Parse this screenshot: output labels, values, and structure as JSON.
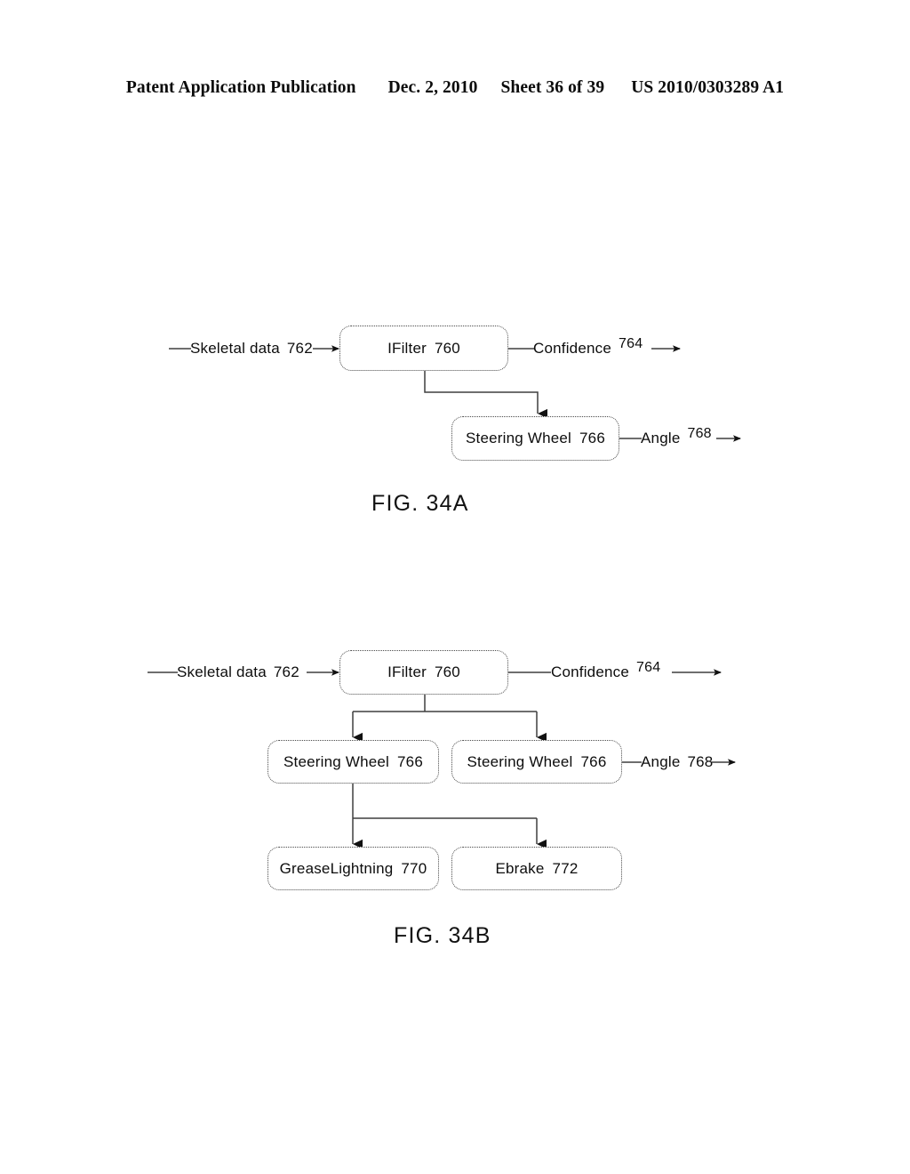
{
  "header": {
    "publication": "Patent Application Publication",
    "date": "Dec. 2, 2010",
    "sheet": "Sheet 36 of 39",
    "patent_number": "US 2010/0303289 A1"
  },
  "figures": [
    {
      "id": "fig-34a",
      "caption": "FIG. 34A",
      "nodes": [
        {
          "id": "a-ifilter",
          "label": "IFilter",
          "ref": "760"
        },
        {
          "id": "a-steering",
          "label": "Steering Wheel",
          "ref": "766"
        }
      ],
      "edge_labels": [
        {
          "id": "a-skeletal",
          "label": "Skeletal data",
          "ref": "762"
        },
        {
          "id": "a-confidence",
          "label": "Confidence",
          "ref": "764"
        },
        {
          "id": "a-angle",
          "label": "Angle",
          "ref": "768"
        }
      ]
    },
    {
      "id": "fig-34b",
      "caption": "FIG. 34B",
      "nodes": [
        {
          "id": "b-ifilter",
          "label": "IFilter",
          "ref": "760"
        },
        {
          "id": "b-steering-1",
          "label": "Steering Wheel",
          "ref": "766"
        },
        {
          "id": "b-steering-2",
          "label": "Steering Wheel",
          "ref": "766"
        },
        {
          "id": "b-grease",
          "label": "GreaseLightning",
          "ref": "770"
        },
        {
          "id": "b-ebrake",
          "label": "Ebrake",
          "ref": "772"
        }
      ],
      "edge_labels": [
        {
          "id": "b-skeletal",
          "label": "Skeletal data",
          "ref": "762"
        },
        {
          "id": "b-confidence",
          "label": "Confidence",
          "ref": "764"
        },
        {
          "id": "b-angle",
          "label": "Angle",
          "ref": "768"
        }
      ]
    }
  ],
  "colors": {
    "ink": "#000000",
    "line": "#3f3f3f",
    "box_border": "#4a4a4a",
    "paper": "#ffffff"
  }
}
